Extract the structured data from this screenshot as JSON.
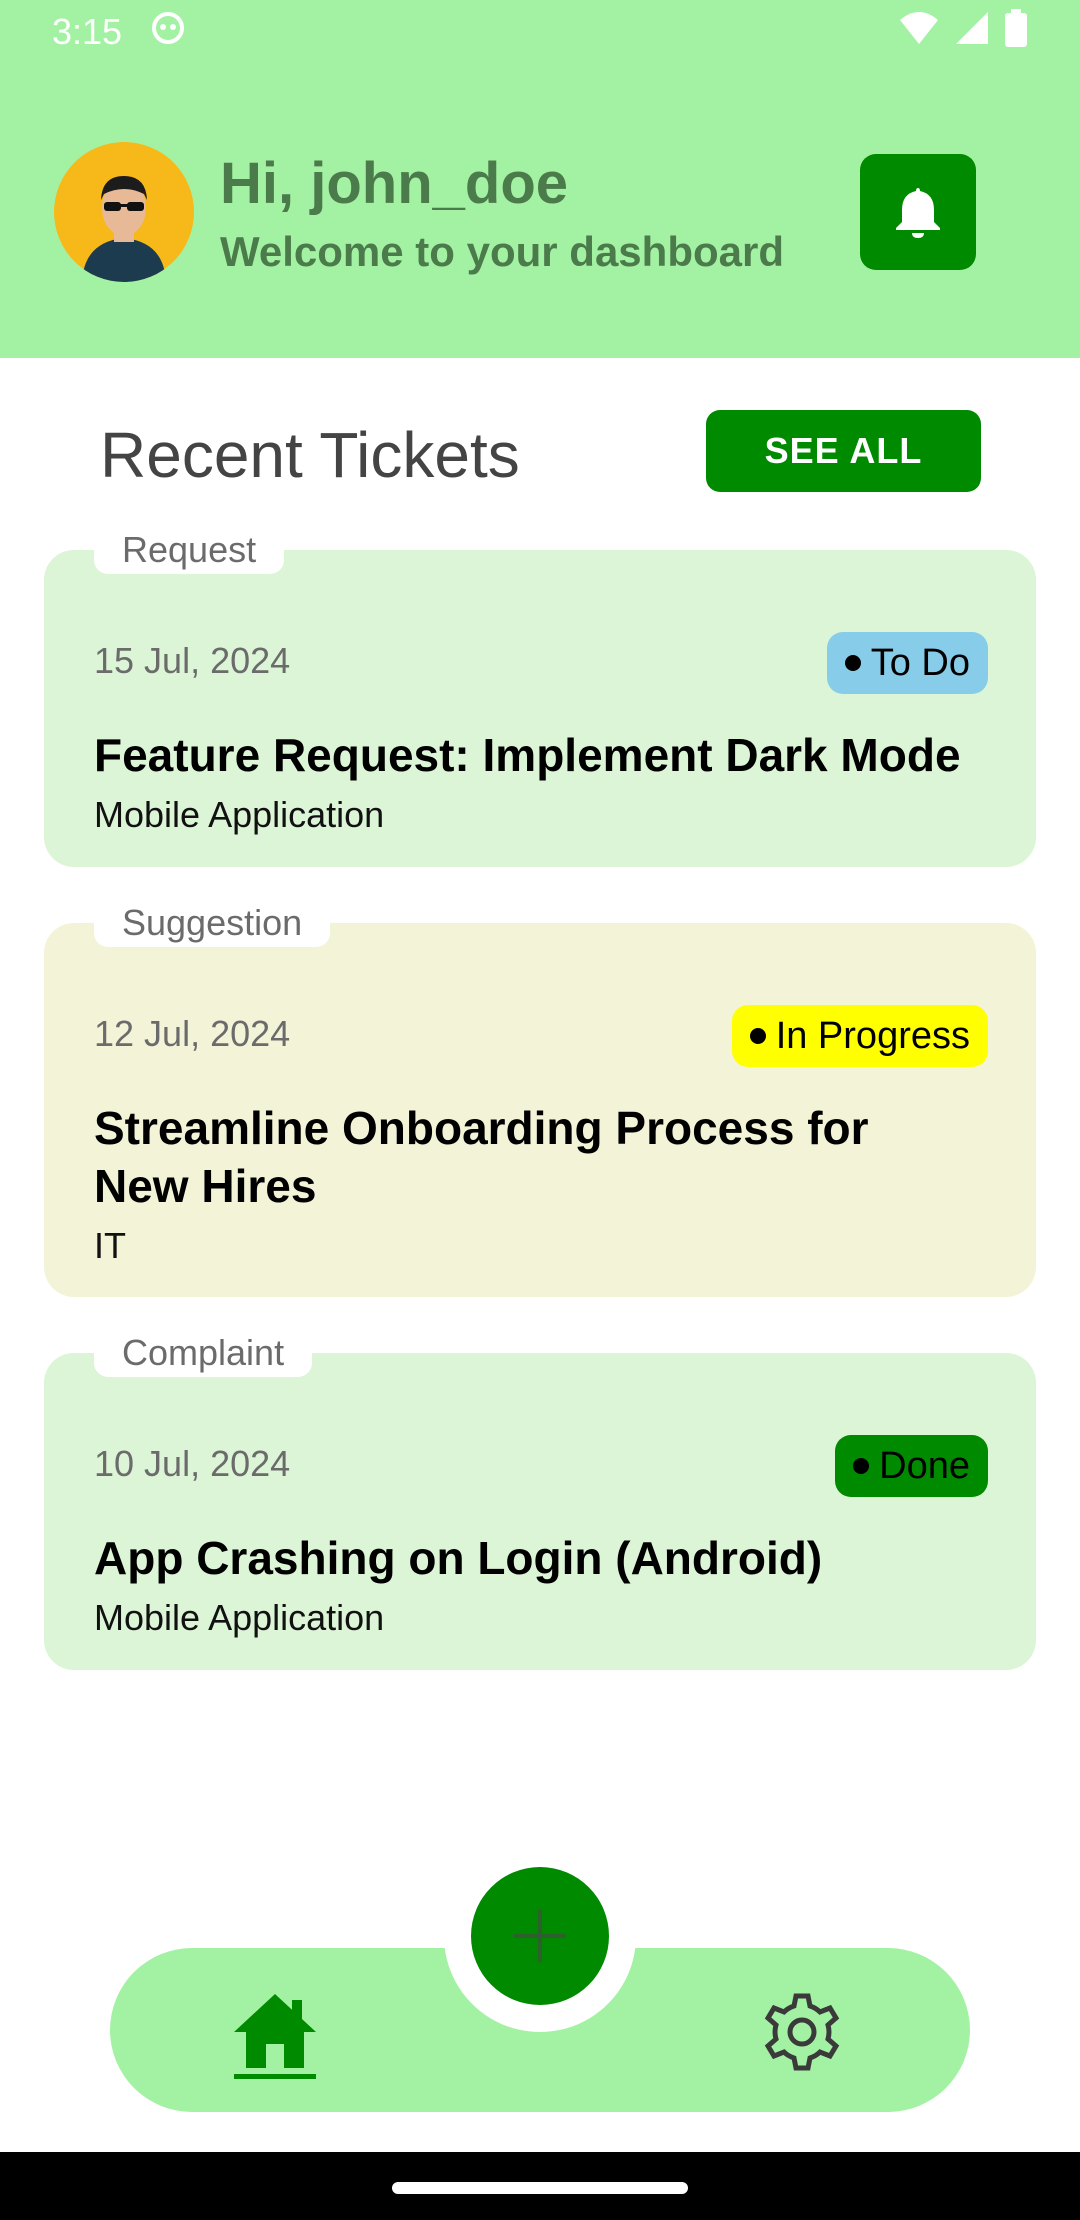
{
  "status_bar": {
    "time": "3:15"
  },
  "header": {
    "greeting": "Hi, john_doe",
    "subtitle": "Welcome to your dashboard"
  },
  "section": {
    "title": "Recent Tickets",
    "see_all_label": "SEE ALL"
  },
  "tickets": [
    {
      "category": "Request",
      "date": "15 Jul, 2024",
      "status": "To Do",
      "status_color": "#87cdea",
      "title": "Feature Request: Implement Dark Mode",
      "department": "Mobile Application",
      "card_color": "#dbf5d6"
    },
    {
      "category": "Suggestion",
      "date": "12 Jul, 2024",
      "status": "In Progress",
      "status_color": "#ffff00",
      "title": "Streamline Onboarding Process for New Hires",
      "department": "IT",
      "card_color": "#f3f3d8"
    },
    {
      "category": "Complaint",
      "date": "10 Jul, 2024",
      "status": "Done",
      "status_color": "#008a00",
      "title": "App Crashing on Login (Android)",
      "department": "Mobile Application",
      "card_color": "#dbf5d6"
    }
  ],
  "nav": {
    "home_icon": "home-icon",
    "add_icon": "plus-icon",
    "settings_icon": "gear-icon"
  },
  "colors": {
    "header_bg": "#a3f2a3",
    "accent": "#008a00",
    "text_muted": "#4b7a4b"
  }
}
